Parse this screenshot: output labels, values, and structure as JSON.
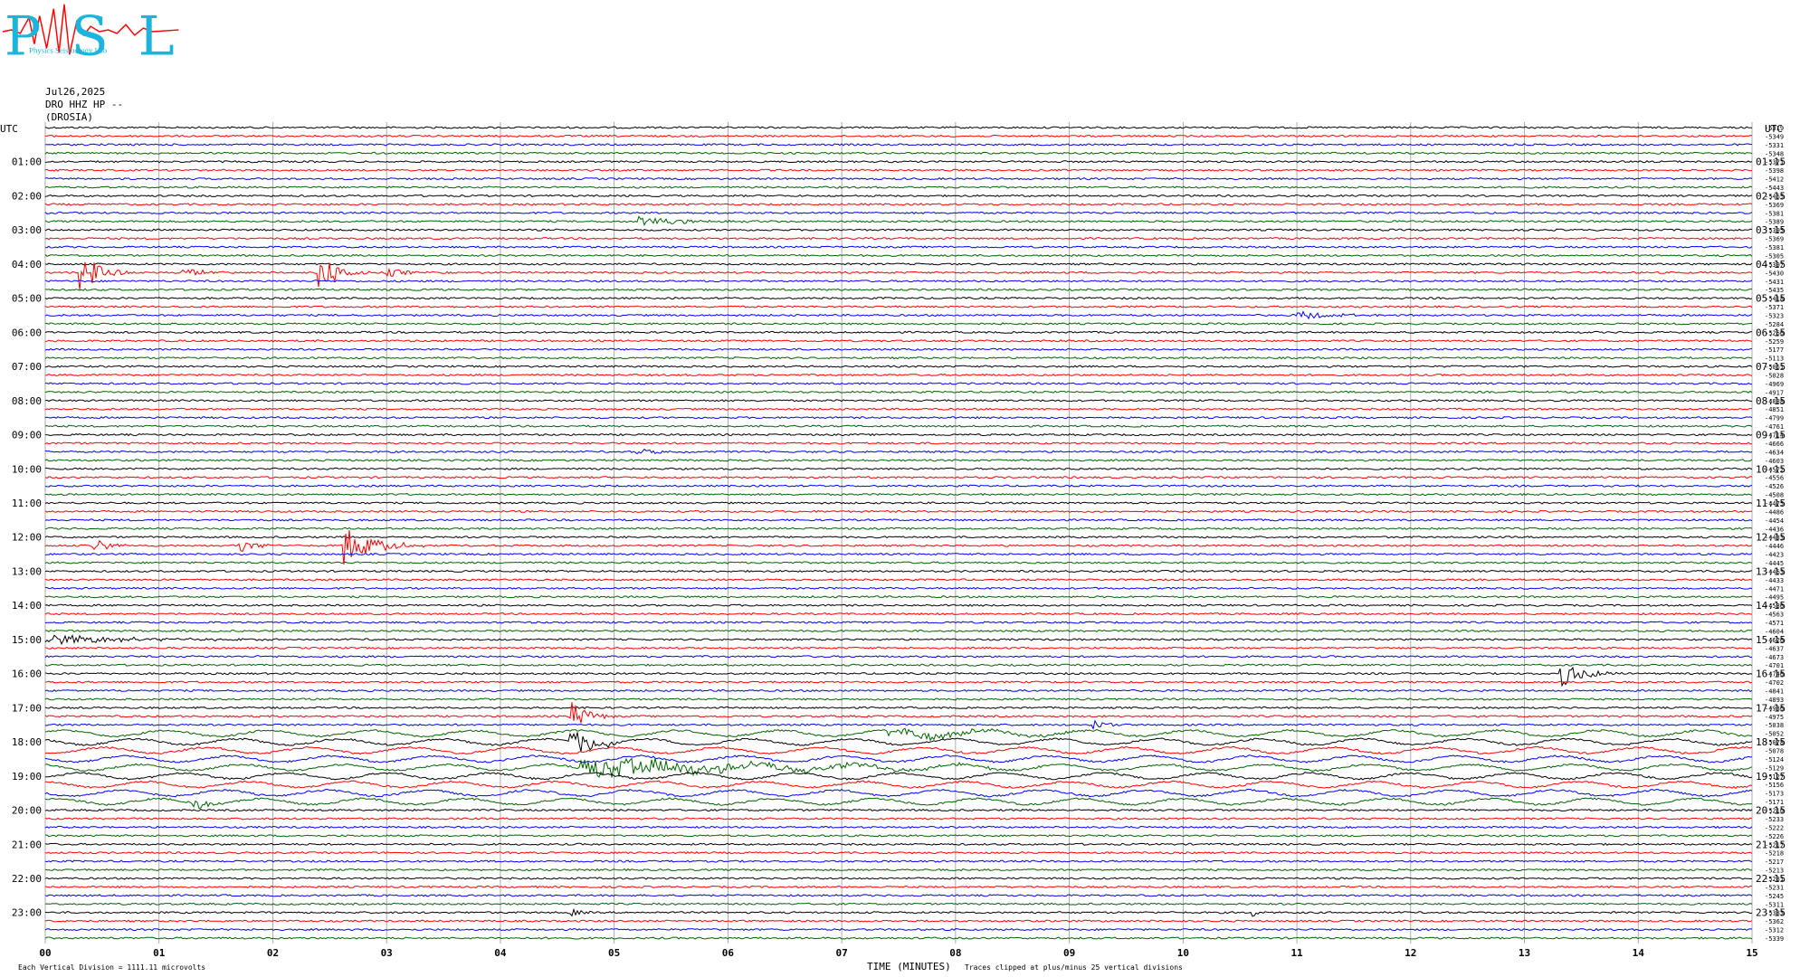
{
  "header": {
    "logo_text": "PSL",
    "logo_subtext": "Physics Seismology Lab",
    "date": "Jul26,2025",
    "station": "DRO HHZ HP --",
    "site": "(DROSIA)"
  },
  "colors": {
    "black": "#000000",
    "red": "#ff0000",
    "blue": "#0000ff",
    "green": "#006400",
    "grid": "#999999",
    "logo": "#1cb4dc",
    "logo_wave": "#ff0000"
  },
  "footer": {
    "scale": "Each Vertical Division = 1111.11 microvolts",
    "axis_title": "TIME (MINUTES)",
    "clip_note": "Traces clipped at plus/minus 25 vertical divisions"
  },
  "chart_data": {
    "type": "line",
    "title": "",
    "xlabel": "TIME (MINUTES)",
    "ylabel": "UTC",
    "x_ticks": [
      "00",
      "01",
      "02",
      "03",
      "04",
      "05",
      "06",
      "07",
      "08",
      "09",
      "10",
      "11",
      "12",
      "13",
      "14",
      "15"
    ],
    "xlim": [
      0,
      15
    ],
    "left_label_header": "UTC",
    "right_label_header": "UTC",
    "left_hour_labels": [
      "01:00",
      "02:00",
      "03:00",
      "04:00",
      "05:00",
      "06:00",
      "07:00",
      "08:00",
      "09:00",
      "10:00",
      "11:00",
      "12:00",
      "13:00",
      "14:00",
      "15:00",
      "16:00",
      "17:00",
      "18:00",
      "19:00",
      "20:00",
      "21:00",
      "22:00",
      "23:00"
    ],
    "right_hour_labels": [
      "01:15",
      "02:15",
      "03:15",
      "04:15",
      "05:15",
      "06:15",
      "07:15",
      "08:15",
      "09:15",
      "10:15",
      "11:15",
      "12:15",
      "13:15",
      "14:15",
      "15:15",
      "16:15",
      "17:15",
      "18:15",
      "19:15",
      "20:15",
      "21:15",
      "22:15",
      "23:15"
    ],
    "trace_color_cycle": [
      "black",
      "red",
      "blue",
      "green"
    ],
    "trace_count": 96,
    "trace_offsets": [
      "-5319",
      "-5349",
      "-5331",
      "-5348",
      "-5371",
      "-5398",
      "-5412",
      "-5443",
      "-5465",
      "-5369",
      "-5381",
      "-5389",
      "-5395",
      "-5369",
      "-5381",
      "-5305",
      "-5397",
      "-5430",
      "-5431",
      "-5435",
      "-5418",
      "-5371",
      "-5323",
      "-5284",
      "-5266",
      "-5259",
      "-5177",
      "-5113",
      "-5061",
      "-5028",
      "-4969",
      "-4917",
      "-4888",
      "-4851",
      "-4799",
      "-4761",
      "-4714",
      "-4666",
      "-4634",
      "-4603",
      "-4572",
      "-4556",
      "-4526",
      "-4508",
      "-4475",
      "-4486",
      "-4454",
      "-4436",
      "-4433",
      "-4446",
      "-4423",
      "-4445",
      "-4463",
      "-4433",
      "-4471",
      "-4495",
      "-4536",
      "-4563",
      "-4571",
      "-4604",
      "-4626",
      "-4637",
      "-4673",
      "-4701",
      "-4746",
      "-4702",
      "-4841",
      "-4893",
      "-4936",
      "-4975",
      "-5038",
      "-5052",
      "-5078",
      "-5078",
      "-5124",
      "-5129",
      "-5127",
      "-5156",
      "-5173",
      "-5171",
      "-5210",
      "-5233",
      "-5222",
      "-5226",
      "-5217",
      "-5218",
      "-5217",
      "-5213",
      "-5231",
      "-5231",
      "-5245",
      "-5311",
      "-5383",
      "-5362",
      "-5312",
      "-5339"
    ]
  }
}
